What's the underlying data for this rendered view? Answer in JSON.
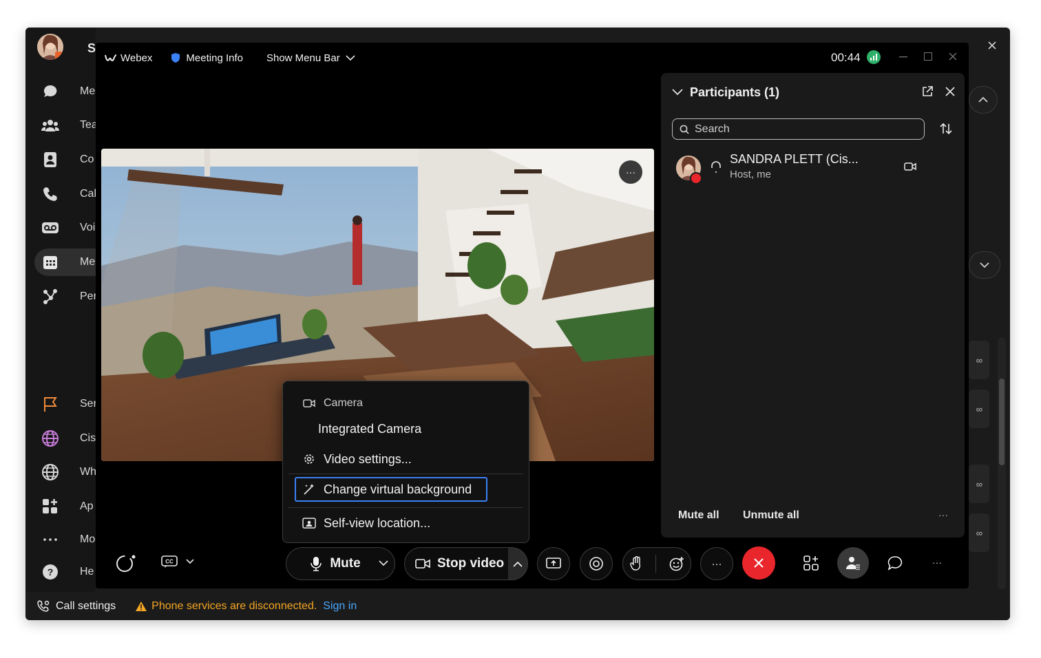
{
  "app": {
    "sidebar": {
      "items": [
        {
          "label": "Me",
          "icon": "chat-icon"
        },
        {
          "label": "Tea",
          "icon": "teams-icon"
        },
        {
          "label": "Co",
          "icon": "contacts-icon"
        },
        {
          "label": "Cal",
          "icon": "phone-icon"
        },
        {
          "label": "Voi",
          "icon": "voicemail-icon"
        },
        {
          "label": "Me",
          "icon": "calendar-icon"
        },
        {
          "label": "Per",
          "icon": "people-icon"
        },
        {
          "label": "Ser",
          "icon": "flag-icon"
        },
        {
          "label": "Cis",
          "icon": "globe-icon"
        },
        {
          "label": "Wh",
          "icon": "globe-icon"
        },
        {
          "label": "Ap",
          "icon": "apps-icon"
        },
        {
          "label": "Mo",
          "icon": "more-icon"
        },
        {
          "label": "He",
          "icon": "help-icon"
        }
      ],
      "header_initial": "S"
    },
    "status_bar": {
      "call_settings": "Call settings",
      "warning": "Phone services are disconnected.",
      "sign_in": "Sign in",
      "warning_color": "#f5a623",
      "link_color": "#4aa8ff"
    }
  },
  "meeting": {
    "brand": "Webex",
    "meeting_info": "Meeting Info",
    "show_menu_bar": "Show Menu Bar",
    "timer": "00:44",
    "video_more": "···",
    "camera_menu": {
      "section": "Camera",
      "camera_name": "Integrated Camera",
      "video_settings": "Video settings...",
      "change_background": "Change virtual background",
      "self_view": "Self-view location..."
    },
    "controls": {
      "mute": "Mute",
      "stop_video": "Stop video",
      "more": "···",
      "end_color": "#e8262c"
    }
  },
  "participants": {
    "title": "Participants (1)",
    "search_placeholder": "Search",
    "list": [
      {
        "name": "SANDRA PLETT (Cis...",
        "role": "Host, me"
      }
    ],
    "mute_all": "Mute all",
    "unmute_all": "Unmute all",
    "more": "···"
  }
}
